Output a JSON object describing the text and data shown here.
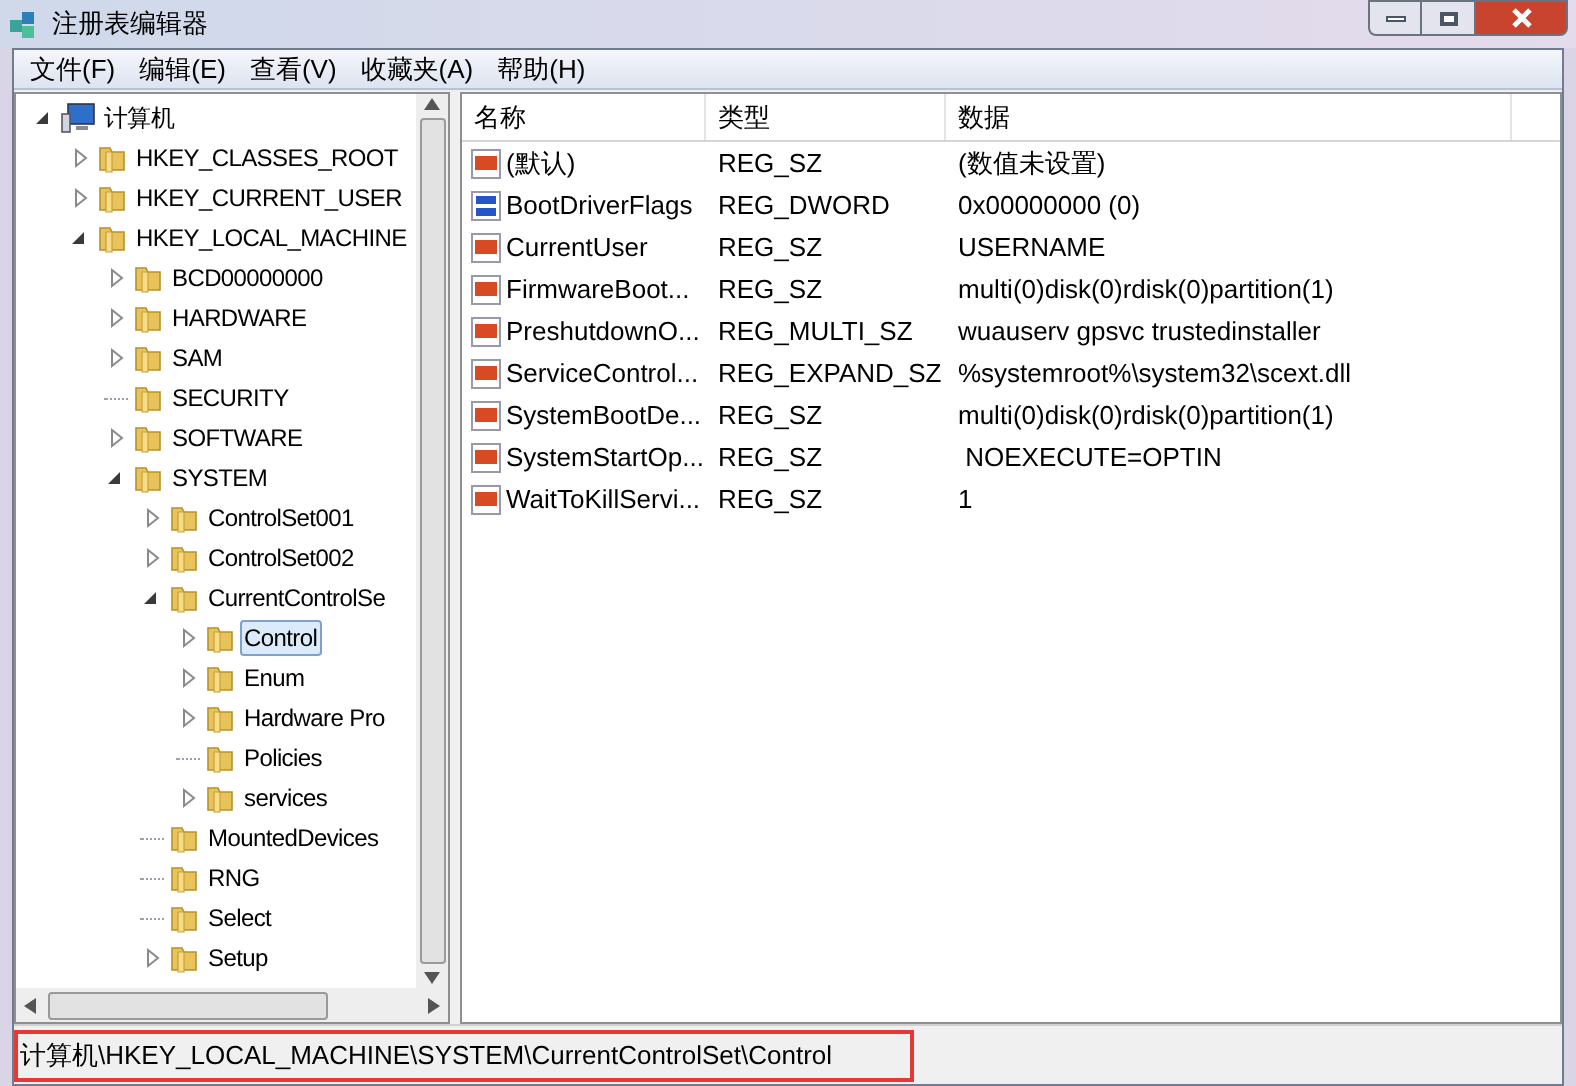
{
  "window": {
    "title": "注册表编辑器"
  },
  "menu": [
    "文件(F)",
    "编辑(E)",
    "查看(V)",
    "收藏夹(A)",
    "帮助(H)"
  ],
  "tree": [
    {
      "label": "计算机",
      "kind": "computer",
      "expanded": true,
      "selected": false,
      "children": [
        {
          "label": "HKEY_CLASSES_ROOT",
          "kind": "branch",
          "expanded": false,
          "selected": false
        },
        {
          "label": "HKEY_CURRENT_USER",
          "kind": "branch",
          "expanded": false,
          "selected": false
        },
        {
          "label": "HKEY_LOCAL_MACHINE",
          "kind": "branch",
          "expanded": true,
          "selected": false,
          "children": [
            {
              "label": "BCD00000000",
              "kind": "branch",
              "expanded": false,
              "selected": false
            },
            {
              "label": "HARDWARE",
              "kind": "branch",
              "expanded": false,
              "selected": false
            },
            {
              "label": "SAM",
              "kind": "branch",
              "expanded": false,
              "selected": false
            },
            {
              "label": "SECURITY",
              "kind": "leaf",
              "expanded": false,
              "selected": false
            },
            {
              "label": "SOFTWARE",
              "kind": "branch",
              "expanded": false,
              "selected": false
            },
            {
              "label": "SYSTEM",
              "kind": "branch",
              "expanded": true,
              "selected": false,
              "children": [
                {
                  "label": "ControlSet001",
                  "kind": "branch",
                  "expanded": false,
                  "selected": false
                },
                {
                  "label": "ControlSet002",
                  "kind": "branch",
                  "expanded": false,
                  "selected": false
                },
                {
                  "label": "CurrentControlSe",
                  "kind": "branch",
                  "expanded": true,
                  "selected": false,
                  "children": [
                    {
                      "label": "Control",
                      "kind": "branch",
                      "expanded": false,
                      "selected": true
                    },
                    {
                      "label": "Enum",
                      "kind": "branch",
                      "expanded": false,
                      "selected": false
                    },
                    {
                      "label": "Hardware Pro",
                      "kind": "branch",
                      "expanded": false,
                      "selected": false
                    },
                    {
                      "label": "Policies",
                      "kind": "leaf",
                      "expanded": false,
                      "selected": false
                    },
                    {
                      "label": "services",
                      "kind": "branch",
                      "expanded": false,
                      "selected": false
                    }
                  ]
                },
                {
                  "label": "MountedDevices",
                  "kind": "leaf",
                  "expanded": false,
                  "selected": false
                },
                {
                  "label": "RNG",
                  "kind": "leaf",
                  "expanded": false,
                  "selected": false
                },
                {
                  "label": "Select",
                  "kind": "leaf",
                  "expanded": false,
                  "selected": false
                },
                {
                  "label": "Setup",
                  "kind": "branch",
                  "expanded": false,
                  "selected": false
                }
              ]
            }
          ]
        }
      ]
    }
  ],
  "table": {
    "columns": [
      "名称",
      "类型",
      "数据"
    ],
    "rows": [
      {
        "kind": "string",
        "name": "(默认)",
        "type": "REG_SZ",
        "data": "(数值未设置)"
      },
      {
        "kind": "binary",
        "name": "BootDriverFlags",
        "type": "REG_DWORD",
        "data": "0x00000000 (0)"
      },
      {
        "kind": "string",
        "name": "CurrentUser",
        "type": "REG_SZ",
        "data": "USERNAME"
      },
      {
        "kind": "string",
        "name": "FirmwareBoot...",
        "type": "REG_SZ",
        "data": "multi(0)disk(0)rdisk(0)partition(1)"
      },
      {
        "kind": "string",
        "name": "PreshutdownO...",
        "type": "REG_MULTI_SZ",
        "data": "wuauserv gpsvc trustedinstaller"
      },
      {
        "kind": "string",
        "name": "ServiceControl...",
        "type": "REG_EXPAND_SZ",
        "data": "%systemroot%\\system32\\scext.dll"
      },
      {
        "kind": "string",
        "name": "SystemBootDe...",
        "type": "REG_SZ",
        "data": "multi(0)disk(0)rdisk(0)partition(1)"
      },
      {
        "kind": "string",
        "name": "SystemStartOp...",
        "type": "REG_SZ",
        "data": " NOEXECUTE=OPTIN"
      },
      {
        "kind": "string",
        "name": "WaitToKillServi...",
        "type": "REG_SZ",
        "data": "1"
      }
    ]
  },
  "status_bar": "计算机\\HKEY_LOCAL_MACHINE\\SYSTEM\\CurrentControlSet\\Control"
}
